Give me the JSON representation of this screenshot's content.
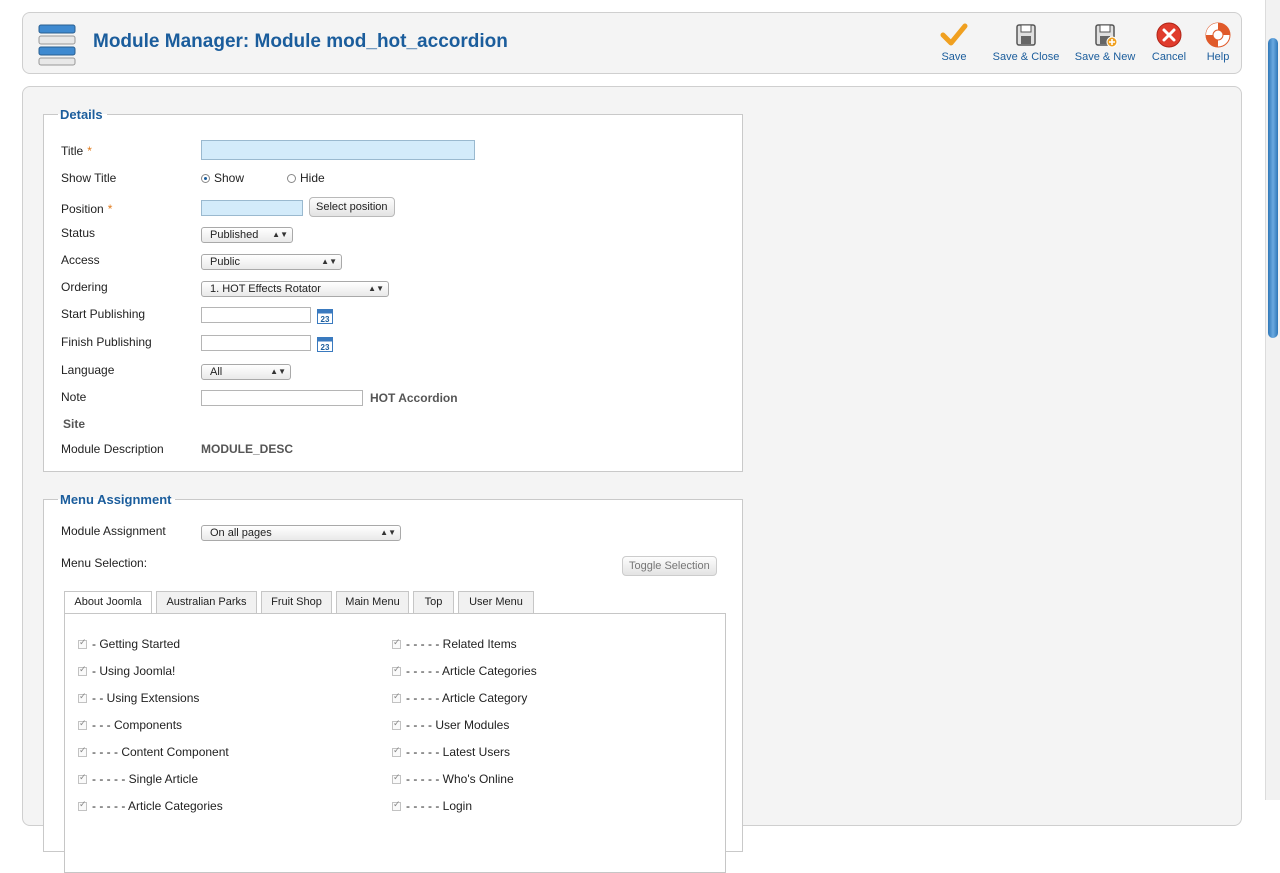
{
  "header": {
    "title": "Module Manager: Module mod_hot_accordion",
    "toolbar": {
      "save": "Save",
      "save_close": "Save & Close",
      "save_new": "Save & New",
      "cancel": "Cancel",
      "help": "Help"
    }
  },
  "details": {
    "legend": "Details",
    "title_label": "Title",
    "required_mark": "*",
    "title_value": "",
    "show_title_label": "Show Title",
    "show_option": "Show",
    "hide_option": "Hide",
    "show_title_selected": "Show",
    "position_label": "Position",
    "position_value": "",
    "select_position_button": "Select position",
    "status_label": "Status",
    "status_value": "Published",
    "access_label": "Access",
    "access_value": "Public",
    "ordering_label": "Ordering",
    "ordering_value": "1. HOT Effects Rotator",
    "start_publishing_label": "Start Publishing",
    "start_publishing_value": "",
    "finish_publishing_label": "Finish Publishing",
    "finish_publishing_value": "",
    "calendar_day": "23",
    "language_label": "Language",
    "language_value": "All",
    "note_label": "Note",
    "note_value": "",
    "note_module_name": "HOT Accordion",
    "site_label": "Site",
    "module_description_label": "Module Description",
    "module_description_value": "MODULE_DESC"
  },
  "menu_assignment": {
    "legend": "Menu Assignment",
    "module_assignment_label": "Module Assignment",
    "module_assignment_value": "On all pages",
    "menu_selection_label": "Menu Selection:",
    "toggle_selection_button": "Toggle Selection",
    "tabs": [
      "About Joomla",
      "Australian Parks",
      "Fruit Shop",
      "Main Menu",
      "Top",
      "User Menu"
    ],
    "active_tab": "About Joomla",
    "items_left": [
      "- Getting Started",
      "- Using Joomla!",
      "- - Using Extensions",
      "- - - Components",
      "- - - - Content Component",
      "- - - - - Single Article",
      "- - - - - Article Categories"
    ],
    "items_right": [
      "- - - - - Related Items",
      "- - - - - Article Categories",
      "- - - - - Article Category",
      "- - - - User Modules",
      "- - - - - Latest Users",
      "- - - - - Who's Online",
      "- - - - - Login"
    ]
  },
  "colors": {
    "brand_blue": "#1b5d9c",
    "required_orange": "#e07a1c",
    "required_field_bg": "#d3ebfa"
  }
}
